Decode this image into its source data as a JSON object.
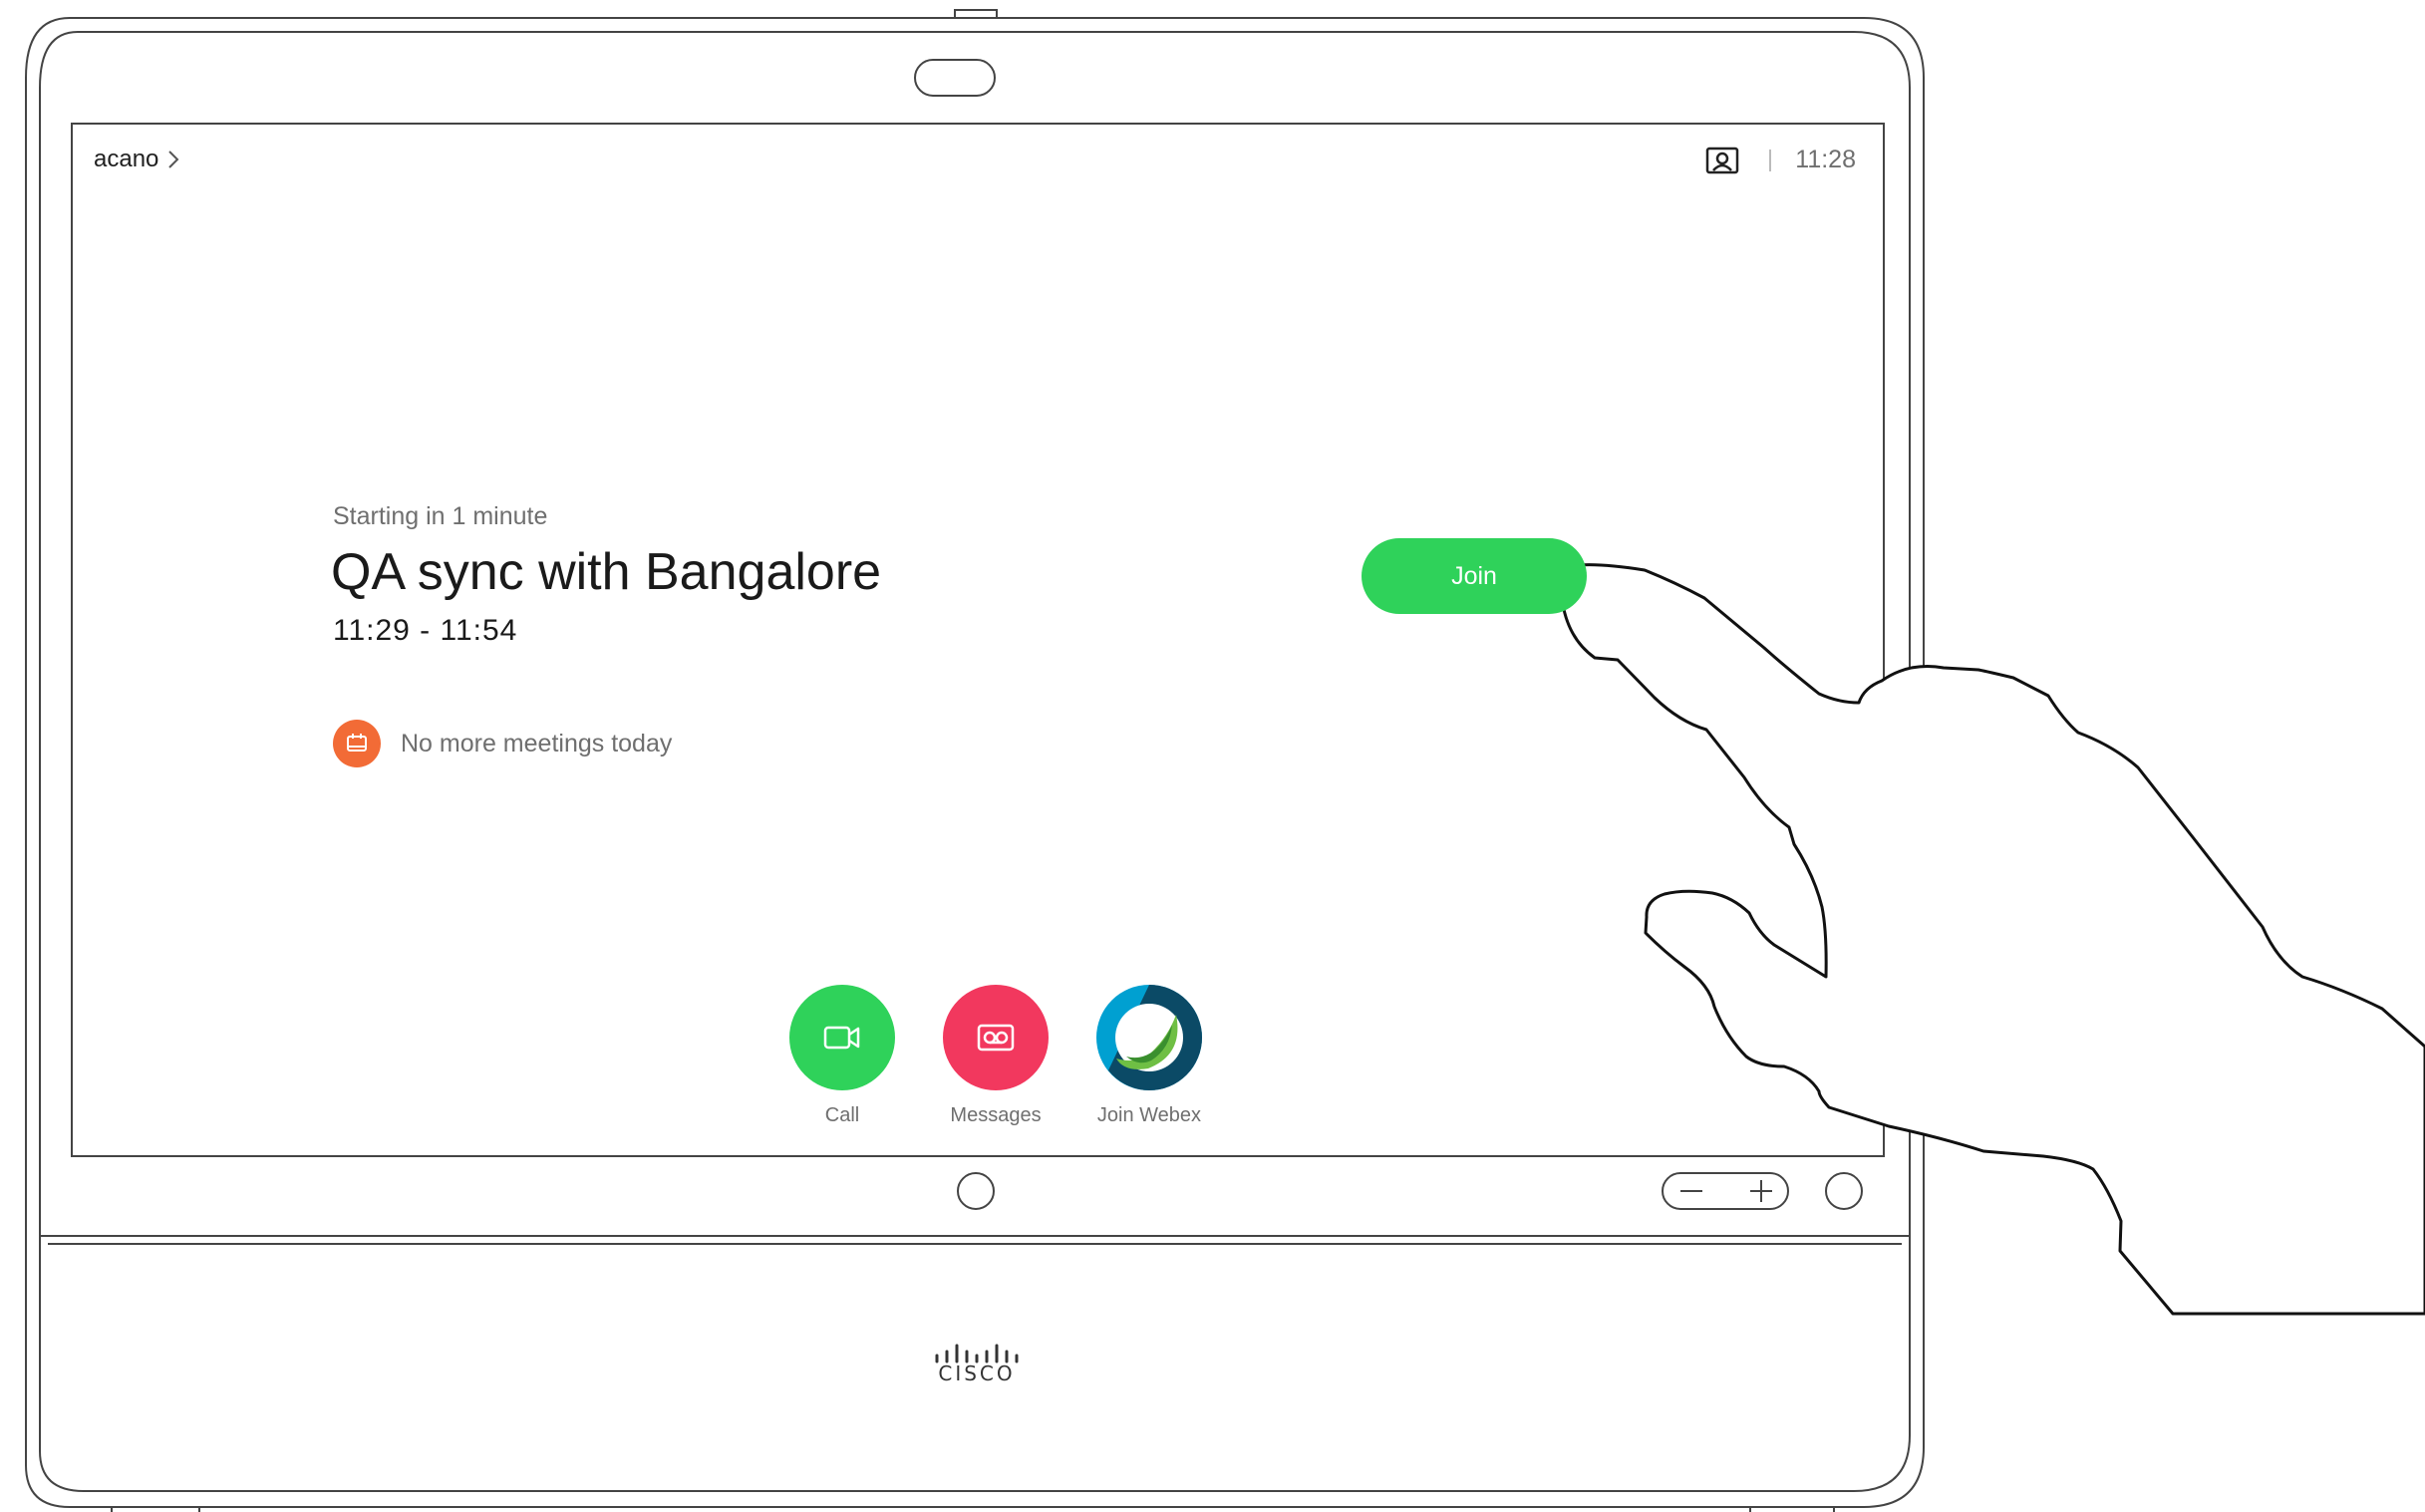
{
  "top_bar": {
    "system_name": "acano",
    "clock": "11:28",
    "icons": {
      "chevron": "chevron-right-icon",
      "self_view": "self-view-icon"
    }
  },
  "meeting": {
    "status": "Starting in 1 minute",
    "title": "QA sync with Bangalore",
    "time_range": "11:29 - 11:54",
    "join_label": "Join"
  },
  "agenda": {
    "message": "No more meetings today",
    "icon": "calendar-icon",
    "icon_color": "#f26b36"
  },
  "apps": [
    {
      "label": "Call",
      "icon": "video-camera-icon",
      "color": "#2fd25a"
    },
    {
      "label": "Messages",
      "icon": "voicemail-icon",
      "color": "#f2385e"
    },
    {
      "label": "Join Webex",
      "icon": "webex-icon",
      "color": "#00a0d1"
    }
  ],
  "device": {
    "brand": "CISCO",
    "hardware_buttons": [
      "home-button",
      "volume-rocker",
      "power-button"
    ]
  },
  "colors": {
    "accent_green": "#2fd25a",
    "text_gray": "#6f6f6f"
  }
}
